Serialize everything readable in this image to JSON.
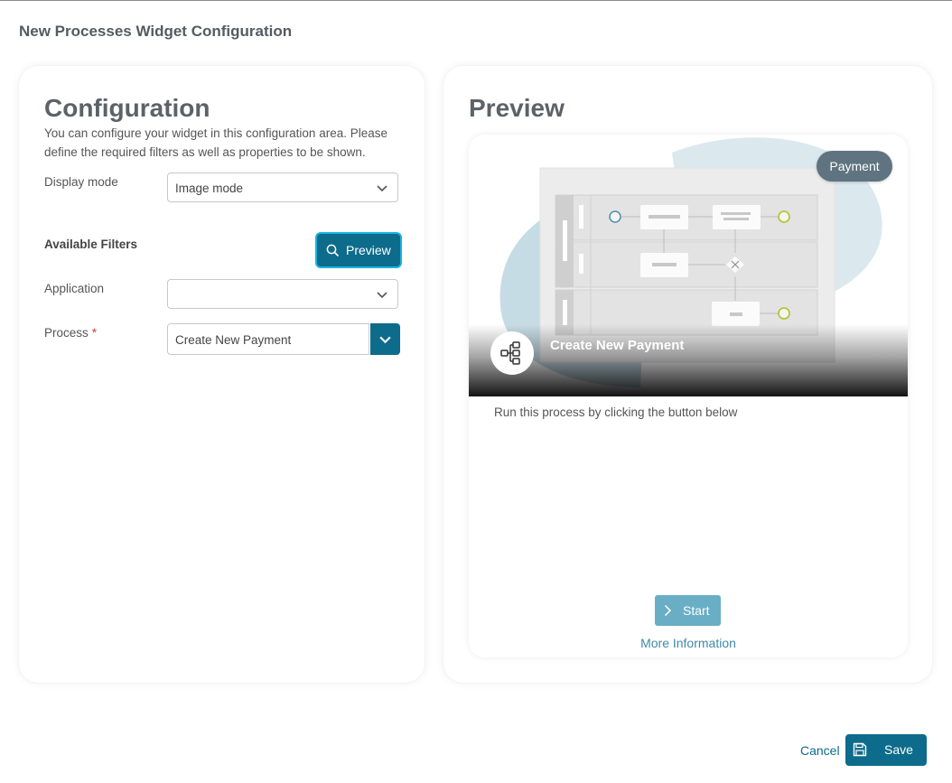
{
  "dialog": {
    "title": "New Processes Widget Configuration"
  },
  "config": {
    "heading": "Configuration",
    "description": "You can configure your widget in this configuration area. Please define the required filters as well as properties to be shown.",
    "display_mode": {
      "label": "Display mode",
      "value": "Image mode"
    },
    "filters_heading": "Available Filters",
    "preview_button": "Preview",
    "application": {
      "label": "Application",
      "value": ""
    },
    "process": {
      "label": "Process",
      "required_marker": "*",
      "value": "Create New Payment"
    }
  },
  "preview": {
    "heading": "Preview",
    "card": {
      "badge": "Payment",
      "title": "Create New Payment",
      "description": "Run this process by clicking the button below",
      "start_label": "Start",
      "more_info": "More Information"
    }
  },
  "footer": {
    "cancel_label": "Cancel",
    "save_label": "Save"
  },
  "colors": {
    "accent": "#0d6b8b",
    "accent_focus": "#18b3e0",
    "start_button": "#6aaec5",
    "badge": "#5f7480",
    "required": "#d63a3a"
  },
  "icons": [
    "chevron-down-icon",
    "search-icon",
    "process-icon",
    "chevron-right-icon",
    "save-icon"
  ]
}
